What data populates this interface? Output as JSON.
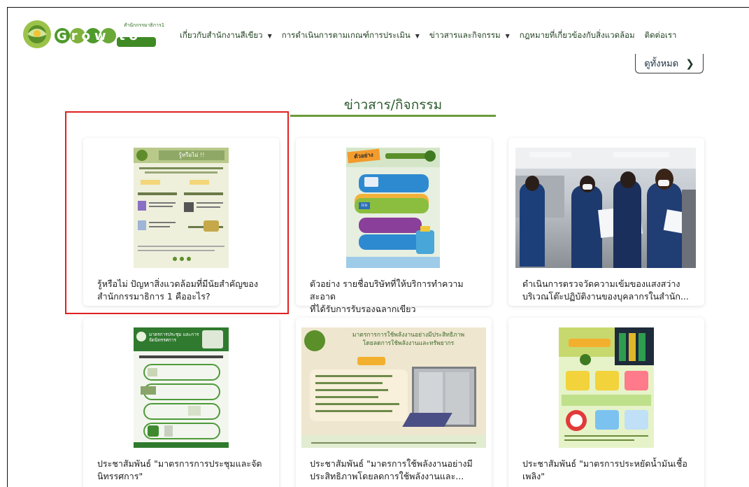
{
  "header": {
    "logo_text": "Grow to Green",
    "logo_sub": "สำนักกรรมาธิการ1",
    "nav": [
      {
        "label": "เกี่ยวกับสำนักงานสีเขียว",
        "has_dropdown": true
      },
      {
        "label": "การดำเนินการตามเกณฑ์การประเมิน",
        "has_dropdown": true
      },
      {
        "label": "ข่าวสารและกิจกรรม",
        "has_dropdown": true
      },
      {
        "label": "กฎหมายที่เกี่ยวข้องกับสิ่งแวดล้อม",
        "has_dropdown": false
      },
      {
        "label": "ติดต่อเรา",
        "has_dropdown": false
      }
    ]
  },
  "view_all": {
    "label": "ดูทั้งหมด"
  },
  "section": {
    "title": "ข่าวสาร/กิจกรรม"
  },
  "cards": [
    {
      "line1": "รู้หรือไม่ ปัญหาสิ่งแวดล้อมที่มีนัยสำคัญของ",
      "line2": "สำนักกรรมาธิการ 1 คืออะไร?",
      "poster_title": "รู้หรือไม่ !!"
    },
    {
      "line1": "ตัวอย่าง รายชื่อบริษัทที่ให้บริการทำความสะอาด",
      "line2": "ที่ได้รับการรับรองฉลากเขียว",
      "poster_title": "ตัวอย่าง"
    },
    {
      "line1": "ดำเนินการตรวจวัดความเข้มของแสงสว่าง",
      "line2": "บริเวณโต๊ะปฏิบัติงานของบุคลากรในสำนัก..."
    },
    {
      "line1": "ประชาสัมพันธ์ \"มาตรการการประชุมและจัด",
      "line2": "นิทรรศการ\"",
      "poster_title": "มาตรการประชุม และการจัดนิทรรศการ"
    },
    {
      "line1": "ประชาสัมพันธ์ \"มาตรการใช้พลังงานอย่างมี",
      "line2": "ประสิทธิภาพโดยลดการใช้พลังงานและ...",
      "poster_title": "มาตรการการใช้พลังงานอย่างมีประสิทธิภาพ",
      "poster_sub": "โดยลดการใช้พลังงานและทรัพยากร"
    },
    {
      "line1": "ประชาสัมพันธ์ \"มาตรการประหยัดน้ำมันเชื้อ",
      "line2": "เพลิง\""
    }
  ],
  "colors": {
    "accent_green": "#6b9b3a",
    "title_green": "#2c5a2e",
    "selection_red": "#e02020"
  }
}
